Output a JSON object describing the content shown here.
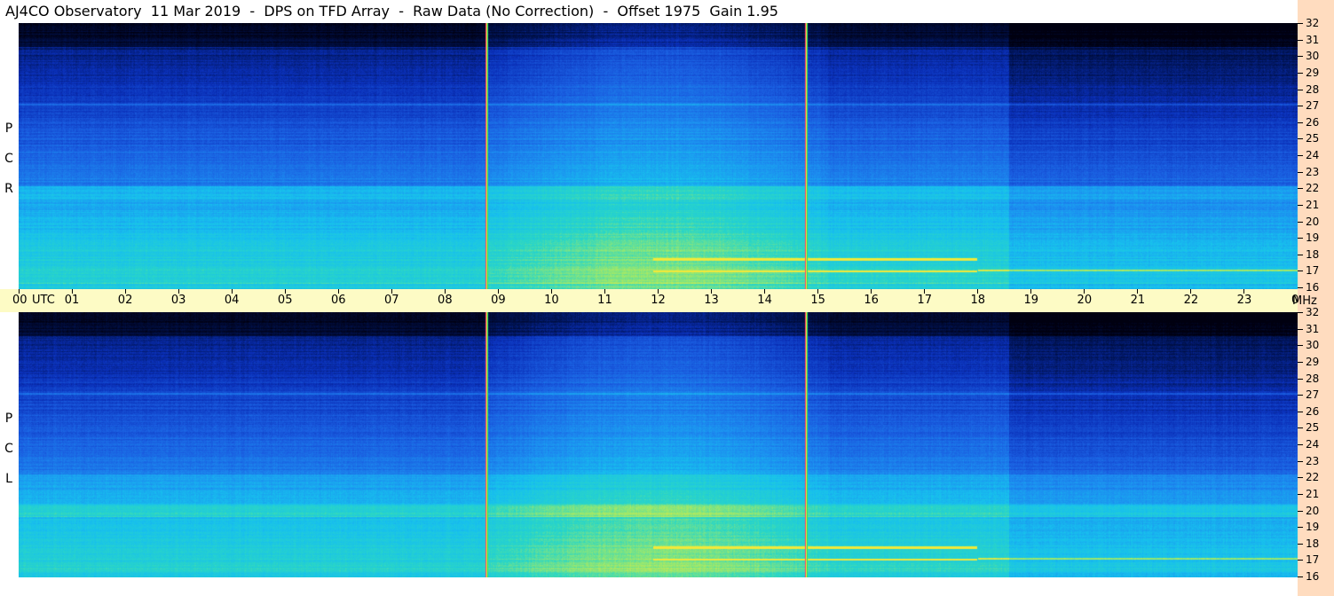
{
  "title": "AJ4CO Observatory  11 Mar 2019  -  DPS on TFD Array  -  Raw Data (No Correction)  -  Offset 1975  Gain 1.95",
  "chart_data": [
    {
      "type": "heatmap",
      "panel": "RCP",
      "polarization_label": [
        "R",
        "C",
        "P"
      ],
      "x": {
        "unit": "UTC",
        "range": [
          0,
          24
        ],
        "ticks": [
          "00",
          "01",
          "02",
          "03",
          "04",
          "05",
          "06",
          "07",
          "08",
          "09",
          "10",
          "11",
          "12",
          "13",
          "14",
          "15",
          "16",
          "17",
          "18",
          "19",
          "20",
          "21",
          "22",
          "23",
          "00"
        ]
      },
      "y": {
        "unit": "MHz",
        "range": [
          16,
          32
        ],
        "ticks": [
          "16",
          "17",
          "18",
          "19",
          "20",
          "21",
          "22",
          "23",
          "24",
          "25",
          "26",
          "27",
          "28",
          "29",
          "30",
          "31",
          "32"
        ]
      },
      "markers_utc": [
        8.78,
        14.78
      ],
      "colormap": [
        "#000010",
        "#00124f",
        "#0a2fb8",
        "#1a5de0",
        "#1c8ef0",
        "#17c0ee",
        "#2ad6c6",
        "#9be86c",
        "#f3e93a"
      ]
    },
    {
      "type": "heatmap",
      "panel": "LCP",
      "polarization_label": [
        "L",
        "C",
        "P"
      ],
      "x": {
        "unit": "UTC",
        "range": [
          0,
          24
        ]
      },
      "y": {
        "unit": "MHz",
        "range": [
          16,
          32
        ],
        "ticks": [
          "16",
          "17",
          "18",
          "19",
          "20",
          "21",
          "22",
          "23",
          "24",
          "25",
          "26",
          "27",
          "28",
          "29",
          "30",
          "31",
          "32"
        ]
      },
      "markers_utc": [
        8.78,
        14.78
      ],
      "colormap": [
        "#000010",
        "#00124f",
        "#0a2fb8",
        "#1a5de0",
        "#1c8ef0",
        "#17c0ee",
        "#2ad6c6",
        "#9be86c",
        "#f3e93a"
      ]
    }
  ],
  "axis": {
    "utc_label": "UTC",
    "mhz_label": "MHz"
  }
}
